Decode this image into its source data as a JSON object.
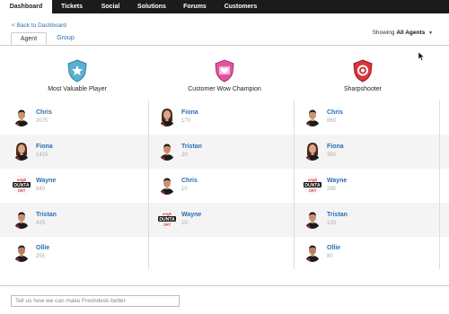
{
  "nav": {
    "tabs": [
      {
        "label": "Dashboard"
      },
      {
        "label": "Tickets"
      },
      {
        "label": "Social"
      },
      {
        "label": "Solutions"
      },
      {
        "label": "Forums"
      },
      {
        "label": "Customers"
      }
    ],
    "active": "Dashboard"
  },
  "back_link": "< Back to Dashboard",
  "subtabs": [
    {
      "label": "Agent"
    },
    {
      "label": "Group"
    }
  ],
  "showing": {
    "prefix": "Showing",
    "value": "All Agents"
  },
  "columns": [
    {
      "title": "Most Valuable Player",
      "badge_icon": "star-shield-icon",
      "badge_color": "#5ab0d0",
      "entries": [
        {
          "name": "Chris",
          "score": "2075"
        },
        {
          "name": "Fiona",
          "score": "1415"
        },
        {
          "name": "Wayne",
          "score": "940"
        },
        {
          "name": "Tristan",
          "score": "425"
        },
        {
          "name": "Ollie",
          "score": "255"
        }
      ]
    },
    {
      "title": "Customer Wow Champion",
      "badge_icon": "heart-shield-icon",
      "badge_color": "#e0559e",
      "entries": [
        {
          "name": "Fiona",
          "score": "170"
        },
        {
          "name": "Tristan",
          "score": "20"
        },
        {
          "name": "Chris",
          "score": "10"
        },
        {
          "name": "Wayne",
          "score": "10"
        }
      ]
    },
    {
      "title": "Sharpshooter",
      "badge_icon": "target-shield-icon",
      "badge_color": "#d9363a",
      "entries": [
        {
          "name": "Chris",
          "score": "860"
        },
        {
          "name": "Fiona",
          "score": "360"
        },
        {
          "name": "Wayne",
          "score": "295"
        },
        {
          "name": "Tristan",
          "score": "120"
        },
        {
          "name": "Ollie",
          "score": "80"
        }
      ]
    }
  ],
  "feedback_placeholder": "Tell us how we can make Freshdesk better",
  "avatar_logo_text": [
    "origh",
    "DUNTA",
    "ORT"
  ]
}
